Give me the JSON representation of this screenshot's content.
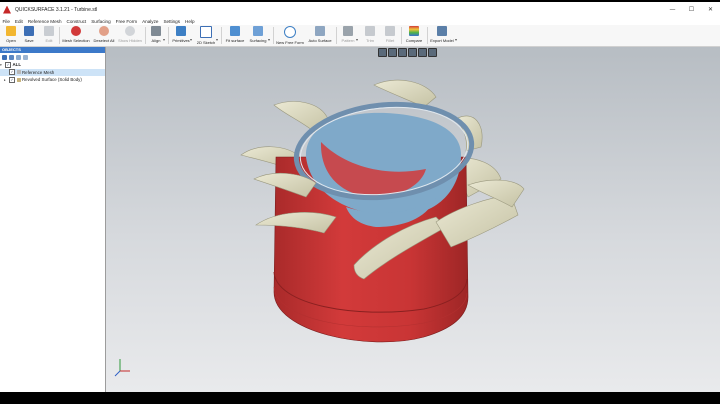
{
  "window": {
    "title": "QUICKSURFACE 3.1.21 - Turbine.stl",
    "controls": [
      "—",
      "☐",
      "✕"
    ]
  },
  "menu": [
    "File",
    "Edit",
    "Reference Mesh",
    "Construct",
    "Surfacing",
    "Free Form",
    "Analyze",
    "Settings",
    "Help"
  ],
  "toolbar": {
    "open": "Open",
    "save": "Save",
    "edit": "Edit",
    "mesh_selection": "Mesh Selection",
    "deselect_all": "Deselect All",
    "show_hidden": "Show Hidden",
    "align": "Align",
    "primitives": "Primitives",
    "sketch_2d": "2D Sketch",
    "fit_surface": "Fit surface",
    "surfacing": "Surfacing",
    "new_free_form": "New Free Form",
    "auto_surface": "Auto Surface",
    "pattern": "Pattern",
    "trim": "Trim",
    "fillet": "Fillet",
    "compare": "Compare",
    "export_model": "Export Model"
  },
  "panel": {
    "header": "OBJECTS",
    "tree": {
      "root": "ALL",
      "items": [
        "Reference Mesh",
        "Revolved Surface (Solid Body)"
      ]
    }
  },
  "colors": {
    "accent": "#3c79c9",
    "mesh_deviation_red": "#d23a3a",
    "surface_blue": "#7fa9c9",
    "blade_beige": "#dcd9bf"
  }
}
